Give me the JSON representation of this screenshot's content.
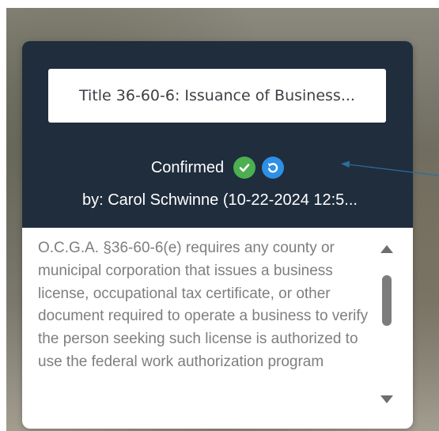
{
  "card": {
    "title": "Title 36-60-6: Issuance of Business...",
    "status_text": "Confirmed",
    "by_text": "by: Carol Schwinne (10-22-2024 12:5...",
    "description": "O.C.G.A. §36-60-6(e) requires any county or municipal corporation that issues a business license, occupational tax certificate, or other document required to operate a business to verify the person seeking such license is authorized to use the federal work authorization program"
  },
  "icons": {
    "confirmed": "check-circle-icon",
    "undo": "undo-icon",
    "scroll_up": "scroll-up-arrow-icon",
    "scroll_down": "scroll-down-arrow-icon"
  },
  "colors": {
    "header_bg": "#1f2d3d",
    "check_green": "#4caf50",
    "undo_blue": "#2e8fe6",
    "arrow": "#2b6f9a"
  }
}
